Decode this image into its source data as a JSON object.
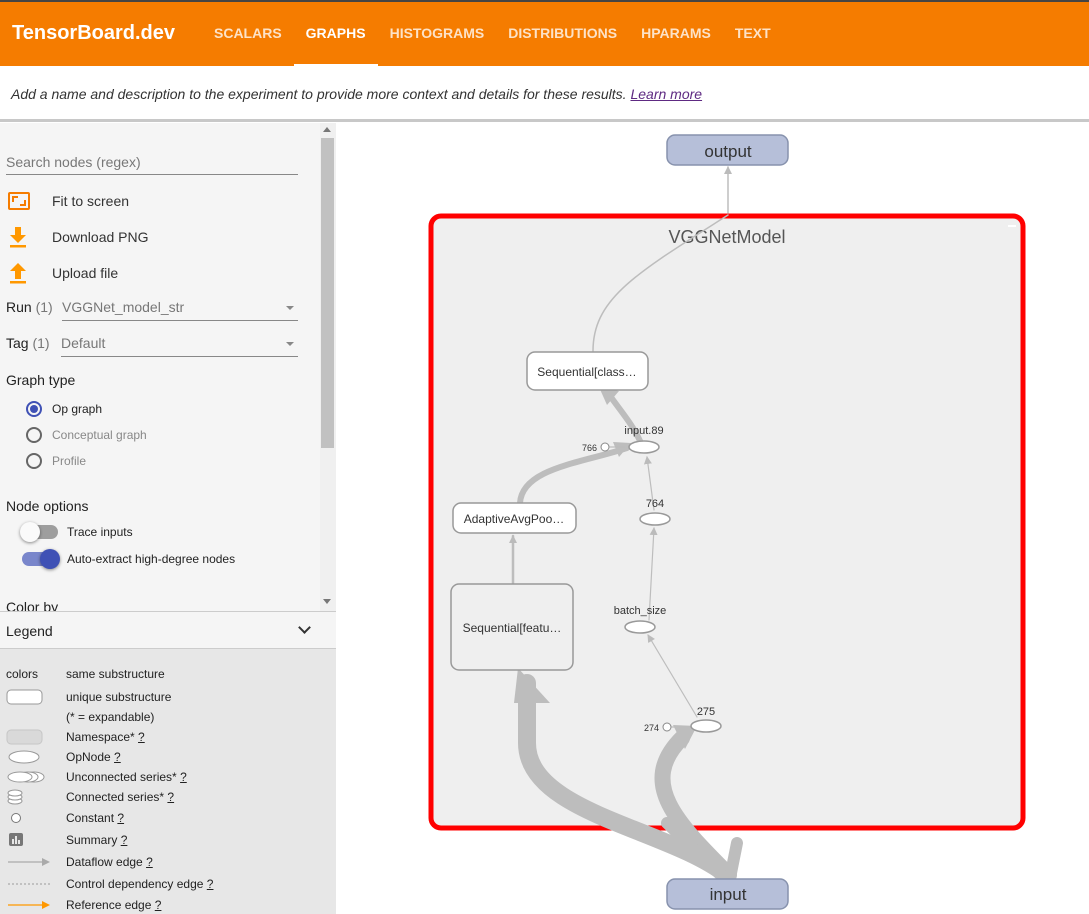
{
  "app": {
    "brand": "TensorBoard.dev"
  },
  "nav": {
    "tabs": [
      {
        "label": "SCALARS",
        "active": false
      },
      {
        "label": "GRAPHS",
        "active": true
      },
      {
        "label": "HISTOGRAMS",
        "active": false
      },
      {
        "label": "DISTRIBUTIONS",
        "active": false
      },
      {
        "label": "HPARAMS",
        "active": false
      },
      {
        "label": "TEXT",
        "active": false
      }
    ]
  },
  "description": {
    "text": "Add a name and description to the experiment to provide more context and details for these results.",
    "link": "Learn more"
  },
  "sidebar": {
    "search_placeholder": "Search nodes (regex)",
    "actions": {
      "fit": "Fit to screen",
      "download": "Download PNG",
      "upload": "Upload file"
    },
    "run": {
      "label": "Run",
      "count": "(1)",
      "value": "VGGNet_model_str"
    },
    "tag": {
      "label": "Tag",
      "count": "(1)",
      "value": "Default"
    },
    "graph_type": {
      "title": "Graph type",
      "options": [
        {
          "label": "Op graph",
          "selected": true
        },
        {
          "label": "Conceptual graph",
          "selected": false
        },
        {
          "label": "Profile",
          "selected": false
        }
      ]
    },
    "node_options": {
      "title": "Node options",
      "trace_inputs": {
        "label": "Trace inputs",
        "on": false
      },
      "auto_extract": {
        "label": "Auto-extract high-degree nodes",
        "on": true
      }
    },
    "color_by": {
      "title": "Color by"
    }
  },
  "legend": {
    "title": "Legend",
    "colors_label": "colors",
    "colors_desc": "same substructure",
    "items": [
      {
        "text": "unique substructure",
        "q": ""
      },
      {
        "text": "(* = expandable)",
        "q": ""
      },
      {
        "text": "Namespace*",
        "q": "?"
      },
      {
        "text": "OpNode",
        "q": "?"
      },
      {
        "text": "Unconnected series*",
        "q": "?"
      },
      {
        "text": "Connected series*",
        "q": "?"
      },
      {
        "text": "Constant",
        "q": "?"
      },
      {
        "text": "Summary",
        "q": "?"
      },
      {
        "text": "Dataflow edge",
        "q": "?"
      },
      {
        "text": "Control dependency edge",
        "q": "?"
      },
      {
        "text": "Reference edge",
        "q": "?"
      }
    ]
  },
  "graph": {
    "outer_nodes": {
      "output": "output",
      "input": "input"
    },
    "group": {
      "name": "VGGNetModel",
      "highlight_color": "#ff0000"
    },
    "nodes": {
      "classifier": "Sequential[class…",
      "features": "Sequential[featu…",
      "pool": "AdaptiveAvgPoo…",
      "input89": "input.89",
      "c766": "766",
      "n764": "764",
      "batch_size": "batch_size",
      "n275": "275",
      "c274": "274"
    }
  },
  "colors": {
    "header": "#f57c00",
    "accent_icon": "#ff9800",
    "radio_selected": "#3f51b5",
    "group_highlight": "#ff0000",
    "io_node_fill": "#b6bfd9"
  }
}
